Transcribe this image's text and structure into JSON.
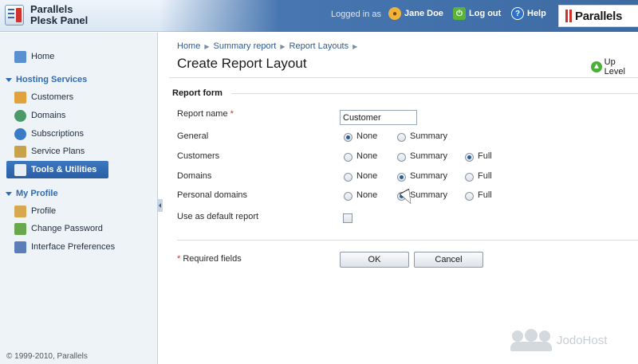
{
  "header": {
    "logo_line1": "Parallels",
    "logo_line2": "Plesk Panel",
    "logged_in_label": "Logged in as",
    "user_name": "Jane Doe",
    "logout_label": "Log out",
    "help_label": "Help",
    "brand": "Parallels"
  },
  "sidebar": {
    "home": "Home",
    "hosting_section": "Hosting Services",
    "hosting_items": [
      "Customers",
      "Domains",
      "Subscriptions",
      "Service Plans",
      "Tools & Utilities"
    ],
    "profile_section": "My Profile",
    "profile_items": [
      "Profile",
      "Change Password",
      "Interface Preferences"
    ],
    "active_item": "Tools & Utilities",
    "copyright": "© 1999-2010, Parallels"
  },
  "breadcrumb": [
    "Home",
    "Summary report",
    "Report Layouts"
  ],
  "page_title": "Create Report Layout",
  "up_level": "Up Level",
  "form": {
    "section_title": "Report form",
    "report_name_label": "Report name",
    "required_mark": "*",
    "report_name_value": "Customer",
    "rows": [
      {
        "label": "General",
        "options": [
          "None",
          "Summary"
        ],
        "selected": "None"
      },
      {
        "label": "Customers",
        "options": [
          "None",
          "Summary",
          "Full"
        ],
        "selected": "Full"
      },
      {
        "label": "Domains",
        "options": [
          "None",
          "Summary",
          "Full"
        ],
        "selected": "Summary"
      },
      {
        "label": "Personal domains",
        "options": [
          "None",
          "Summary",
          "Full"
        ],
        "selected": "Summary"
      }
    ],
    "default_report_label": "Use as default report",
    "default_report_checked": false,
    "required_note": "Required fields",
    "ok_label": "OK",
    "cancel_label": "Cancel"
  },
  "watermark": "JodoHost",
  "colors": {
    "header_blue": "#3d6aa3",
    "accent_red": "#d0332b",
    "active_nav": "#2f6bb3"
  }
}
